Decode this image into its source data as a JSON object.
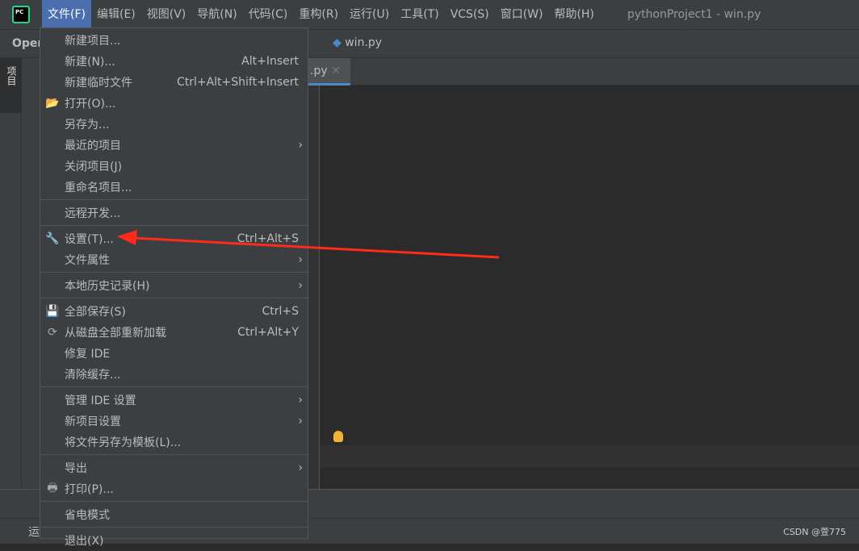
{
  "menubar": {
    "items": [
      "文件(F)",
      "编辑(E)",
      "视图(V)",
      "导航(N)",
      "代码(C)",
      "重构(R)",
      "运行(U)",
      "工具(T)",
      "VCS(S)",
      "窗口(W)",
      "帮助(H)"
    ],
    "window_title": "pythonProject1 - win.py"
  },
  "navbar": {
    "project": "Oper",
    "file": "win.py"
  },
  "left_tab": "项目",
  "editor_tab": ".py",
  "status": {
    "run": "运",
    "watermark": "CSDN @萱775"
  },
  "file_menu": [
    [
      {
        "label": "新建项目...",
        "icon": ""
      },
      {
        "label": "新建(N)...",
        "shortcut": "Alt+Insert"
      },
      {
        "label": "新建临时文件",
        "shortcut": "Ctrl+Alt+Shift+Insert"
      },
      {
        "label": "打开(O)...",
        "icon": "folder-open-icon"
      },
      {
        "label": "另存为..."
      },
      {
        "label": "最近的项目",
        "submenu": true
      },
      {
        "label": "关闭项目(J)"
      },
      {
        "label": "重命名项目..."
      }
    ],
    [
      {
        "label": "远程开发..."
      }
    ],
    [
      {
        "label": "设置(T)...",
        "shortcut": "Ctrl+Alt+S",
        "icon": "wrench-icon"
      },
      {
        "label": "文件属性",
        "submenu": true
      }
    ],
    [
      {
        "label": "本地历史记录(H)",
        "submenu": true
      }
    ],
    [
      {
        "label": "全部保存(S)",
        "shortcut": "Ctrl+S",
        "icon": "save-icon"
      },
      {
        "label": "从磁盘全部重新加载",
        "shortcut": "Ctrl+Alt+Y",
        "icon": "reload-icon"
      },
      {
        "label": "修复 IDE"
      },
      {
        "label": "清除缓存..."
      }
    ],
    [
      {
        "label": "管理 IDE 设置",
        "submenu": true
      },
      {
        "label": "新项目设置",
        "submenu": true
      },
      {
        "label": "将文件另存为模板(L)..."
      }
    ],
    [
      {
        "label": "导出",
        "submenu": true
      },
      {
        "label": "打印(P)...",
        "icon": "print-icon"
      }
    ],
    [
      {
        "label": "省电模式"
      }
    ],
    [
      {
        "label": "退出(X)"
      }
    ]
  ],
  "annotation": {
    "arrow_color": "#ff2a1a"
  }
}
